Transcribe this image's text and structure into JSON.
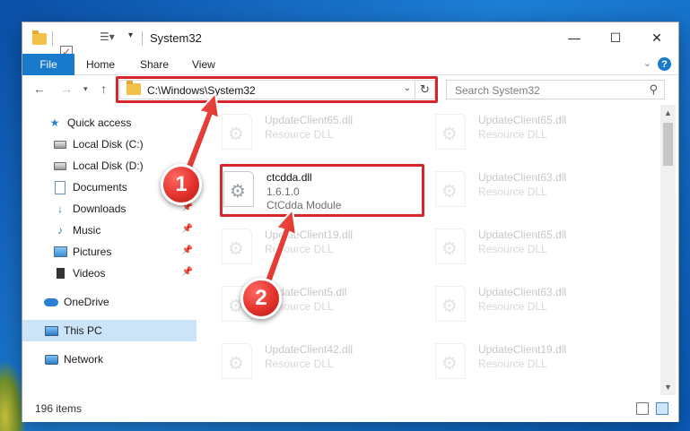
{
  "window": {
    "title": "System32",
    "controls": {
      "minimize": "—",
      "maximize": "☐",
      "close": "✕"
    }
  },
  "ribbon": {
    "tabs": [
      "File",
      "Home",
      "Share",
      "View"
    ]
  },
  "address_bar": {
    "path": "C:\\Windows\\System32",
    "search_placeholder": "Search System32"
  },
  "nav_pane": {
    "items": [
      {
        "label": "Quick access",
        "icon": "star-icon",
        "pinned": false
      },
      {
        "label": "Local Disk (C:)",
        "icon": "drive-icon",
        "pinned": false
      },
      {
        "label": "Local Disk (D:)",
        "icon": "drive-icon",
        "pinned": false
      },
      {
        "label": "Documents",
        "icon": "documents-icon",
        "pinned": true
      },
      {
        "label": "Downloads",
        "icon": "download-icon",
        "pinned": true
      },
      {
        "label": "Music",
        "icon": "music-icon",
        "pinned": true
      },
      {
        "label": "Pictures",
        "icon": "pictures-icon",
        "pinned": true
      },
      {
        "label": "Videos",
        "icon": "videos-icon",
        "pinned": true
      },
      {
        "label": "OneDrive",
        "icon": "onedrive-icon",
        "pinned": false
      },
      {
        "label": "This PC",
        "icon": "this-pc-icon",
        "pinned": false,
        "selected": true
      },
      {
        "label": "Network",
        "icon": "network-icon",
        "pinned": false
      }
    ]
  },
  "files": {
    "highlighted": {
      "name": "ctcdda.dll",
      "version": "1.6.1.0",
      "description": "CtCdda Module"
    },
    "background": [
      {
        "name": "UpdateClient65.dll",
        "type": "Resource DLL"
      },
      {
        "name": "UpdateClient65.dll",
        "type": "Resource DLL"
      },
      {
        "name": "UpdateClient63.dll",
        "type": "Resource DLL"
      },
      {
        "name": "UpdateClient19.dll",
        "type": "Resource DLL"
      },
      {
        "name": "UpdateClient65.dll",
        "type": "Resource DLL"
      },
      {
        "name": "UpdateClient5.dll",
        "type": "Resource DLL"
      },
      {
        "name": "UpdateClient63.dll",
        "type": "Resource DLL"
      },
      {
        "name": "UpdateClient42.dll",
        "type": "Resource DLL"
      },
      {
        "name": "UpdateClient19.dll",
        "type": "Resource DLL"
      }
    ]
  },
  "status_bar": {
    "item_count": "196 items"
  },
  "callouts": [
    "1",
    "2"
  ],
  "colors": {
    "accent": "#1979ca",
    "highlight": "#d7262b",
    "selection": "#cce4f7"
  }
}
